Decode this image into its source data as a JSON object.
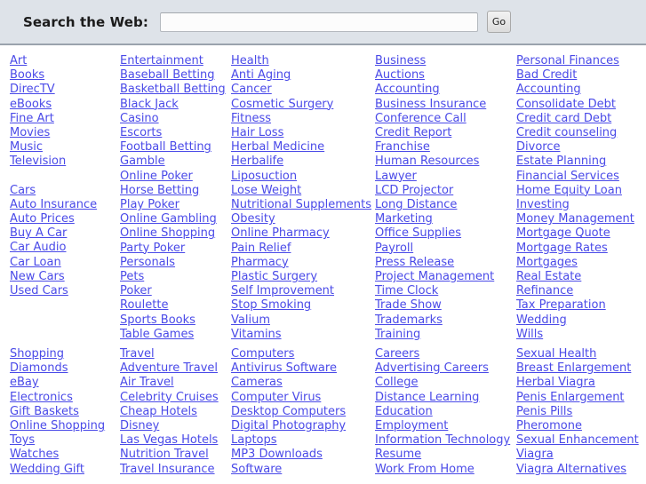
{
  "search": {
    "label": "Search the Web:",
    "input_value": "",
    "placeholder": "",
    "go_label": "Go"
  },
  "colors": {
    "link": "#4a4ae8",
    "header_background": "#dee3e9",
    "header_border": "#9aa3ad",
    "page_background": "#ffffff"
  },
  "directory": {
    "sections": [
      {
        "columns": [
          {
            "groups": [
              {
                "links": [
                  "Art",
                  "Books",
                  "DirecTV",
                  "eBooks",
                  "Fine Art",
                  "Movies",
                  "Music",
                  "Television"
                ]
              },
              {
                "links": [
                  "Cars",
                  "Auto Insurance",
                  "Auto Prices",
                  "Buy A Car",
                  "Car Audio",
                  "Car Loan",
                  "New Cars",
                  "Used Cars"
                ]
              }
            ]
          },
          {
            "groups": [
              {
                "links": [
                  "Entertainment",
                  "Baseball Betting",
                  "Basketball Betting",
                  "Black Jack",
                  "Casino",
                  "Escorts",
                  "Football Betting",
                  "Gamble",
                  "Online Poker",
                  "Horse Betting",
                  "Play Poker",
                  "Online Gambling",
                  "Online Shopping",
                  "Party Poker",
                  "Personals",
                  "Pets",
                  "Poker",
                  "Roulette",
                  "Sports Books",
                  "Table Games"
                ]
              }
            ]
          },
          {
            "groups": [
              {
                "links": [
                  "Health",
                  "Anti Aging",
                  "Cancer",
                  "Cosmetic Surgery",
                  "Fitness",
                  "Hair Loss",
                  "Herbal Medicine",
                  "Herbalife",
                  "Liposuction",
                  "Lose Weight",
                  "Nutritional Supplements",
                  "Obesity",
                  "Online Pharmacy",
                  "Pain Relief",
                  "Pharmacy",
                  "Plastic Surgery",
                  "Self Improvement",
                  "Stop Smoking",
                  "Valium",
                  "Vitamins"
                ]
              }
            ]
          },
          {
            "groups": [
              {
                "links": [
                  "Business",
                  "Auctions",
                  "Accounting",
                  "Business Insurance",
                  "Conference Call",
                  "Credit Report",
                  "Franchise",
                  "Human Resources",
                  "Lawyer",
                  "LCD Projector",
                  "Long Distance",
                  "Marketing",
                  "Office Supplies",
                  "Payroll",
                  "Press Release",
                  "Project Management",
                  "Time Clock",
                  "Trade Show",
                  "Trademarks",
                  "Training"
                ]
              }
            ]
          },
          {
            "groups": [
              {
                "links": [
                  "Personal Finances",
                  "Bad Credit",
                  "Accounting",
                  "Consolidate Debt",
                  "Credit card Debt",
                  "Credit counseling",
                  "Divorce",
                  "Estate Planning",
                  "Financial Services",
                  "Home Equity Loan",
                  "Investing",
                  "Money Management",
                  "Mortgage Quote",
                  "Mortgage Rates",
                  "Mortgages",
                  "Real Estate",
                  "Refinance",
                  "Tax Preparation",
                  "Wedding",
                  "Wills"
                ]
              }
            ]
          }
        ]
      },
      {
        "columns": [
          {
            "groups": [
              {
                "links": [
                  "Shopping",
                  "Diamonds",
                  "eBay",
                  "Electronics",
                  "Gift Baskets",
                  "Online Shopping",
                  "Toys",
                  "Watches",
                  "Wedding Gift"
                ]
              }
            ]
          },
          {
            "groups": [
              {
                "links": [
                  "Travel",
                  "Adventure Travel",
                  "Air Travel",
                  "Celebrity Cruises",
                  "Cheap Hotels",
                  "Disney",
                  "Las Vegas Hotels",
                  "Nutrition Travel",
                  "Travel Insurance"
                ]
              }
            ]
          },
          {
            "groups": [
              {
                "links": [
                  "Computers",
                  "Antivirus Software",
                  "Cameras",
                  "Computer Virus",
                  "Desktop Computers",
                  "Digital Photography",
                  "Laptops",
                  "MP3 Downloads",
                  "Software"
                ]
              }
            ]
          },
          {
            "groups": [
              {
                "links": [
                  "Careers",
                  "Advertising Careers",
                  "College",
                  "Distance Learning",
                  "Education",
                  "Employment",
                  "Information Technology",
                  "Resume",
                  "Work From Home"
                ]
              }
            ]
          },
          {
            "groups": [
              {
                "links": [
                  "Sexual Health",
                  "Breast Enlargement",
                  "Herbal Viagra",
                  "Penis Enlargement",
                  "Penis Pills",
                  "Pheromone",
                  "Sexual Enhancement",
                  "Viagra",
                  "Viagra Alternatives"
                ]
              }
            ]
          }
        ]
      }
    ]
  }
}
